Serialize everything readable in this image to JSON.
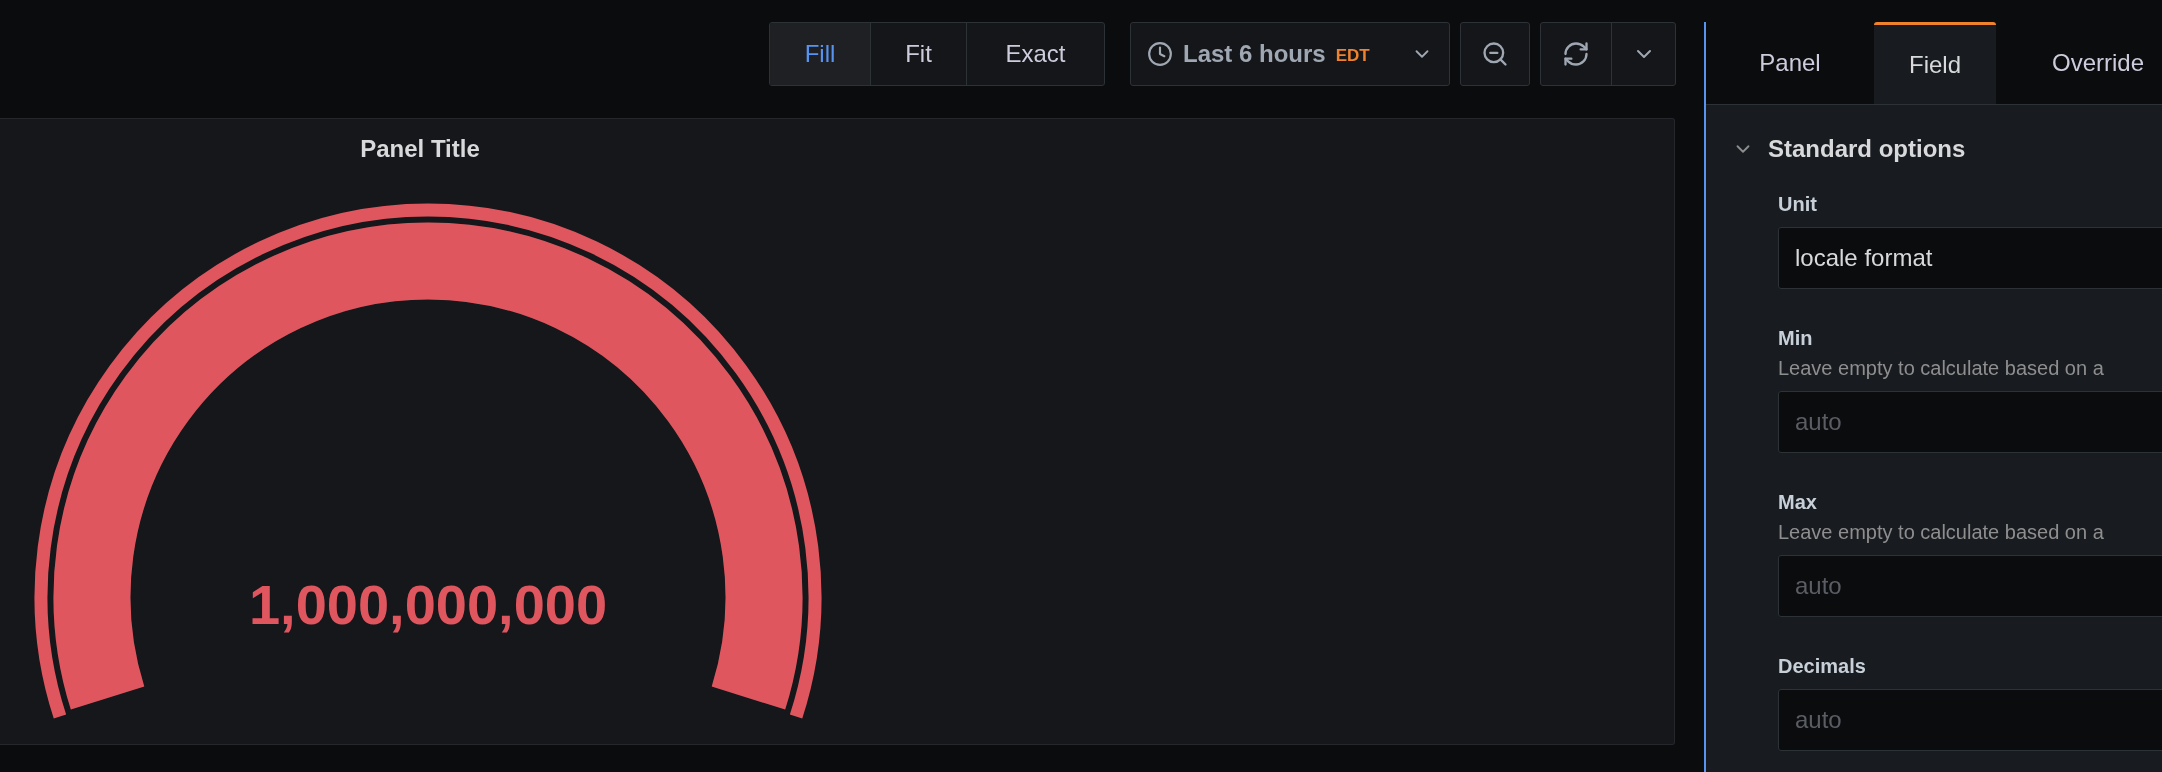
{
  "toolbar": {
    "view_modes": [
      {
        "label": "Fill",
        "selected": true
      },
      {
        "label": "Fit",
        "selected": false
      },
      {
        "label": "Exact",
        "selected": false
      }
    ],
    "time_picker": {
      "label": "Last 6 hours",
      "timezone": "EDT"
    }
  },
  "panel": {
    "title": "Panel Title",
    "gauge": {
      "value": "1,000,000,000"
    }
  },
  "editor": {
    "tabs": [
      {
        "label": "Panel",
        "selected": false
      },
      {
        "label": "Field",
        "selected": true
      },
      {
        "label": "Override",
        "selected": false
      }
    ],
    "section": {
      "title": "Standard options",
      "expanded": true,
      "fields": [
        {
          "label": "Unit",
          "value": "locale format"
        },
        {
          "label": "Min",
          "description": "Leave empty to calculate based on a",
          "placeholder": "auto"
        },
        {
          "label": "Max",
          "description": "Leave empty to calculate based on a",
          "placeholder": "auto"
        },
        {
          "label": "Decimals",
          "placeholder": "auto"
        }
      ]
    }
  }
}
